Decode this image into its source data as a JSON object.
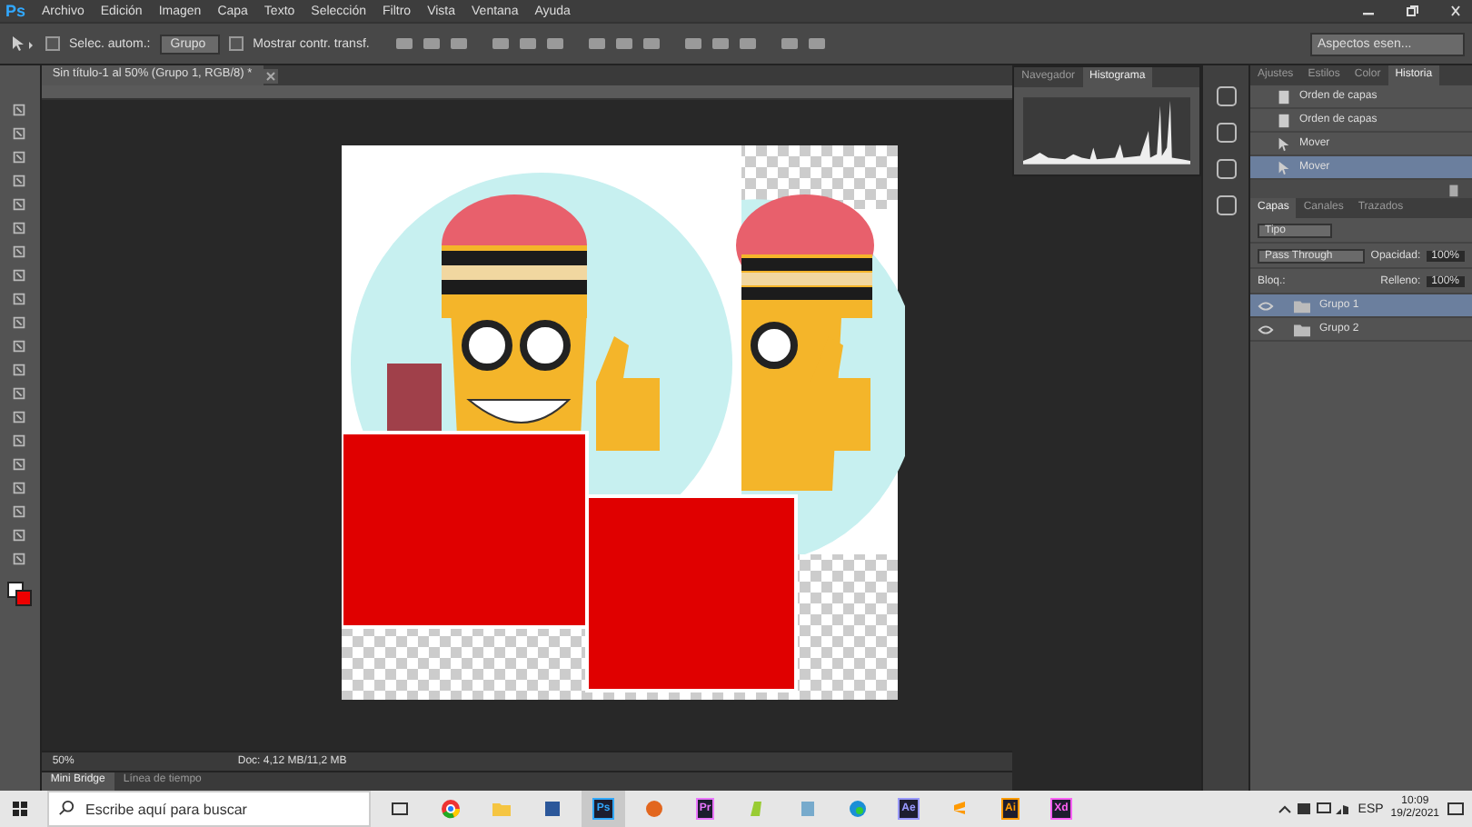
{
  "app_logo": "Ps",
  "menu": [
    "Archivo",
    "Edición",
    "Imagen",
    "Capa",
    "Texto",
    "Selección",
    "Filtro",
    "Vista",
    "Ventana",
    "Ayuda"
  ],
  "options_bar": {
    "auto_select": {
      "label": "Selec. autom.:",
      "checked": false
    },
    "auto_select_target": "Grupo",
    "show_transform": {
      "label": "Mostrar contr. transf.",
      "checked": false
    },
    "workspace": "Aspectos esen..."
  },
  "document": {
    "tab": "Sin título-1 al 50% (Grupo 1, RGB/8) *",
    "zoom": "50%",
    "doc_info": "Doc: 4,12 MB/11,2 MB"
  },
  "bottom_tabs": [
    {
      "label": "Mini Bridge",
      "selected": true
    },
    {
      "label": "Línea de tiempo",
      "selected": false
    }
  ],
  "histogram_panel": {
    "tabs": [
      {
        "label": "Navegador",
        "selected": false
      },
      {
        "label": "Histograma",
        "selected": true
      }
    ]
  },
  "history_panel": {
    "tabs": [
      {
        "label": "Ajustes",
        "selected": false
      },
      {
        "label": "Estilos",
        "selected": false
      },
      {
        "label": "Color",
        "selected": false
      },
      {
        "label": "Historia",
        "selected": true
      }
    ],
    "items": [
      {
        "label": "Orden de capas",
        "kind": "layers",
        "selected": false
      },
      {
        "label": "Orden de capas",
        "kind": "layers",
        "selected": false
      },
      {
        "label": "Mover",
        "kind": "move",
        "selected": false
      },
      {
        "label": "Mover",
        "kind": "move",
        "selected": true
      }
    ]
  },
  "layers_panel": {
    "tabs": [
      {
        "label": "Capas",
        "selected": true
      },
      {
        "label": "Canales",
        "selected": false
      },
      {
        "label": "Trazados",
        "selected": false
      }
    ],
    "filter": "Tipo",
    "blend_mode": "Pass Through",
    "opacity_label": "Opacidad:",
    "opacity": "100%",
    "lock_label": "Bloq.:",
    "fill_label": "Relleno:",
    "fill": "100%",
    "layers": [
      {
        "name": "Grupo 1",
        "selected": true,
        "visible": true
      },
      {
        "name": "Grupo 2",
        "selected": false,
        "visible": true
      }
    ]
  },
  "taskbar": {
    "search_placeholder": "Escribe aquí para buscar",
    "apps": [
      {
        "kind": "taskview",
        "selected": false
      },
      {
        "kind": "chrome",
        "selected": false
      },
      {
        "kind": "folder",
        "selected": false
      },
      {
        "kind": "word",
        "selected": false
      },
      {
        "kind": "adobe",
        "label": "Ps",
        "color": "#31a8ff",
        "selected": true
      },
      {
        "kind": "orange",
        "selected": false
      },
      {
        "kind": "adobe",
        "label": "Pr",
        "color": "#ea77ff",
        "selected": false
      },
      {
        "kind": "green",
        "selected": false
      },
      {
        "kind": "note",
        "selected": false
      },
      {
        "kind": "edge",
        "selected": false
      },
      {
        "kind": "adobe",
        "label": "Ae",
        "color": "#9999ff",
        "selected": false
      },
      {
        "kind": "sublime",
        "selected": false
      },
      {
        "kind": "adobe",
        "label": "Ai",
        "color": "#ff9a00",
        "selected": false
      },
      {
        "kind": "adobe",
        "label": "Xd",
        "color": "#ff61f6",
        "selected": false
      }
    ],
    "language": "ESP",
    "time": "10:09",
    "date": "19/2/2021"
  }
}
